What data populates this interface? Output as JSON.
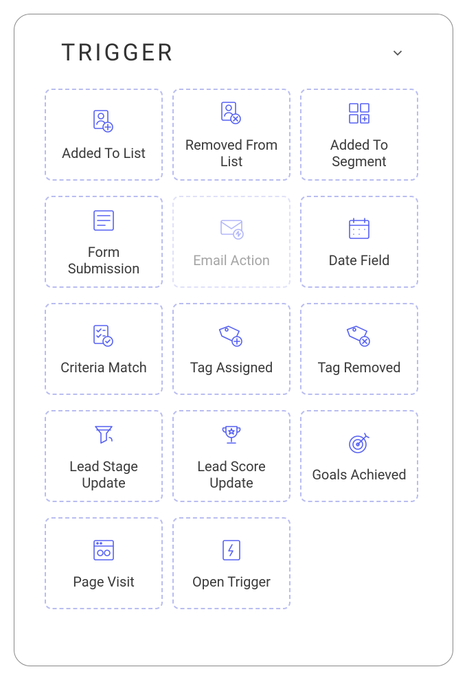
{
  "header": {
    "title": "TRIGGER"
  },
  "triggers": [
    {
      "id": "added-to-list",
      "label": "Added To List",
      "icon": "person-list-add",
      "disabled": false
    },
    {
      "id": "removed-from-list",
      "label": "Removed From List",
      "icon": "person-list-remove",
      "disabled": false
    },
    {
      "id": "added-to-segment",
      "label": "Added To Segment",
      "icon": "segment-add",
      "disabled": false
    },
    {
      "id": "form-submission",
      "label": "Form Submission",
      "icon": "form",
      "disabled": false
    },
    {
      "id": "email-action",
      "label": "Email Action",
      "icon": "email-action",
      "disabled": true
    },
    {
      "id": "date-field",
      "label": "Date Field",
      "icon": "calendar",
      "disabled": false
    },
    {
      "id": "criteria-match",
      "label": "Criteria Match",
      "icon": "checklist",
      "disabled": false
    },
    {
      "id": "tag-assigned",
      "label": "Tag Assigned",
      "icon": "tag-add",
      "disabled": false
    },
    {
      "id": "tag-removed",
      "label": "Tag Removed",
      "icon": "tag-remove",
      "disabled": false
    },
    {
      "id": "lead-stage-update",
      "label": "Lead Stage Update",
      "icon": "funnel",
      "disabled": false
    },
    {
      "id": "lead-score-update",
      "label": "Lead Score Update",
      "icon": "trophy",
      "disabled": false
    },
    {
      "id": "goals-achieved",
      "label": "Goals Achieved",
      "icon": "target",
      "disabled": false
    },
    {
      "id": "page-visit",
      "label": "Page Visit",
      "icon": "browser",
      "disabled": false
    },
    {
      "id": "open-trigger",
      "label": "Open Trigger",
      "icon": "lightning",
      "disabled": false
    }
  ]
}
